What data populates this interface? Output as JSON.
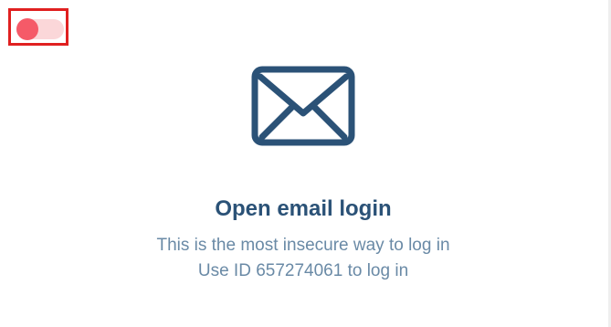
{
  "toggle": {
    "state": "off",
    "knob_color": "#f55a68",
    "track_color": "#fbd7d9",
    "highlight_color": "#e02020"
  },
  "icon": {
    "name": "envelope-icon",
    "color": "#2b5277"
  },
  "content": {
    "title": "Open email login",
    "description_line1": "This is the most insecure way to log in",
    "description_line2": "Use ID 657274061 to log in"
  }
}
